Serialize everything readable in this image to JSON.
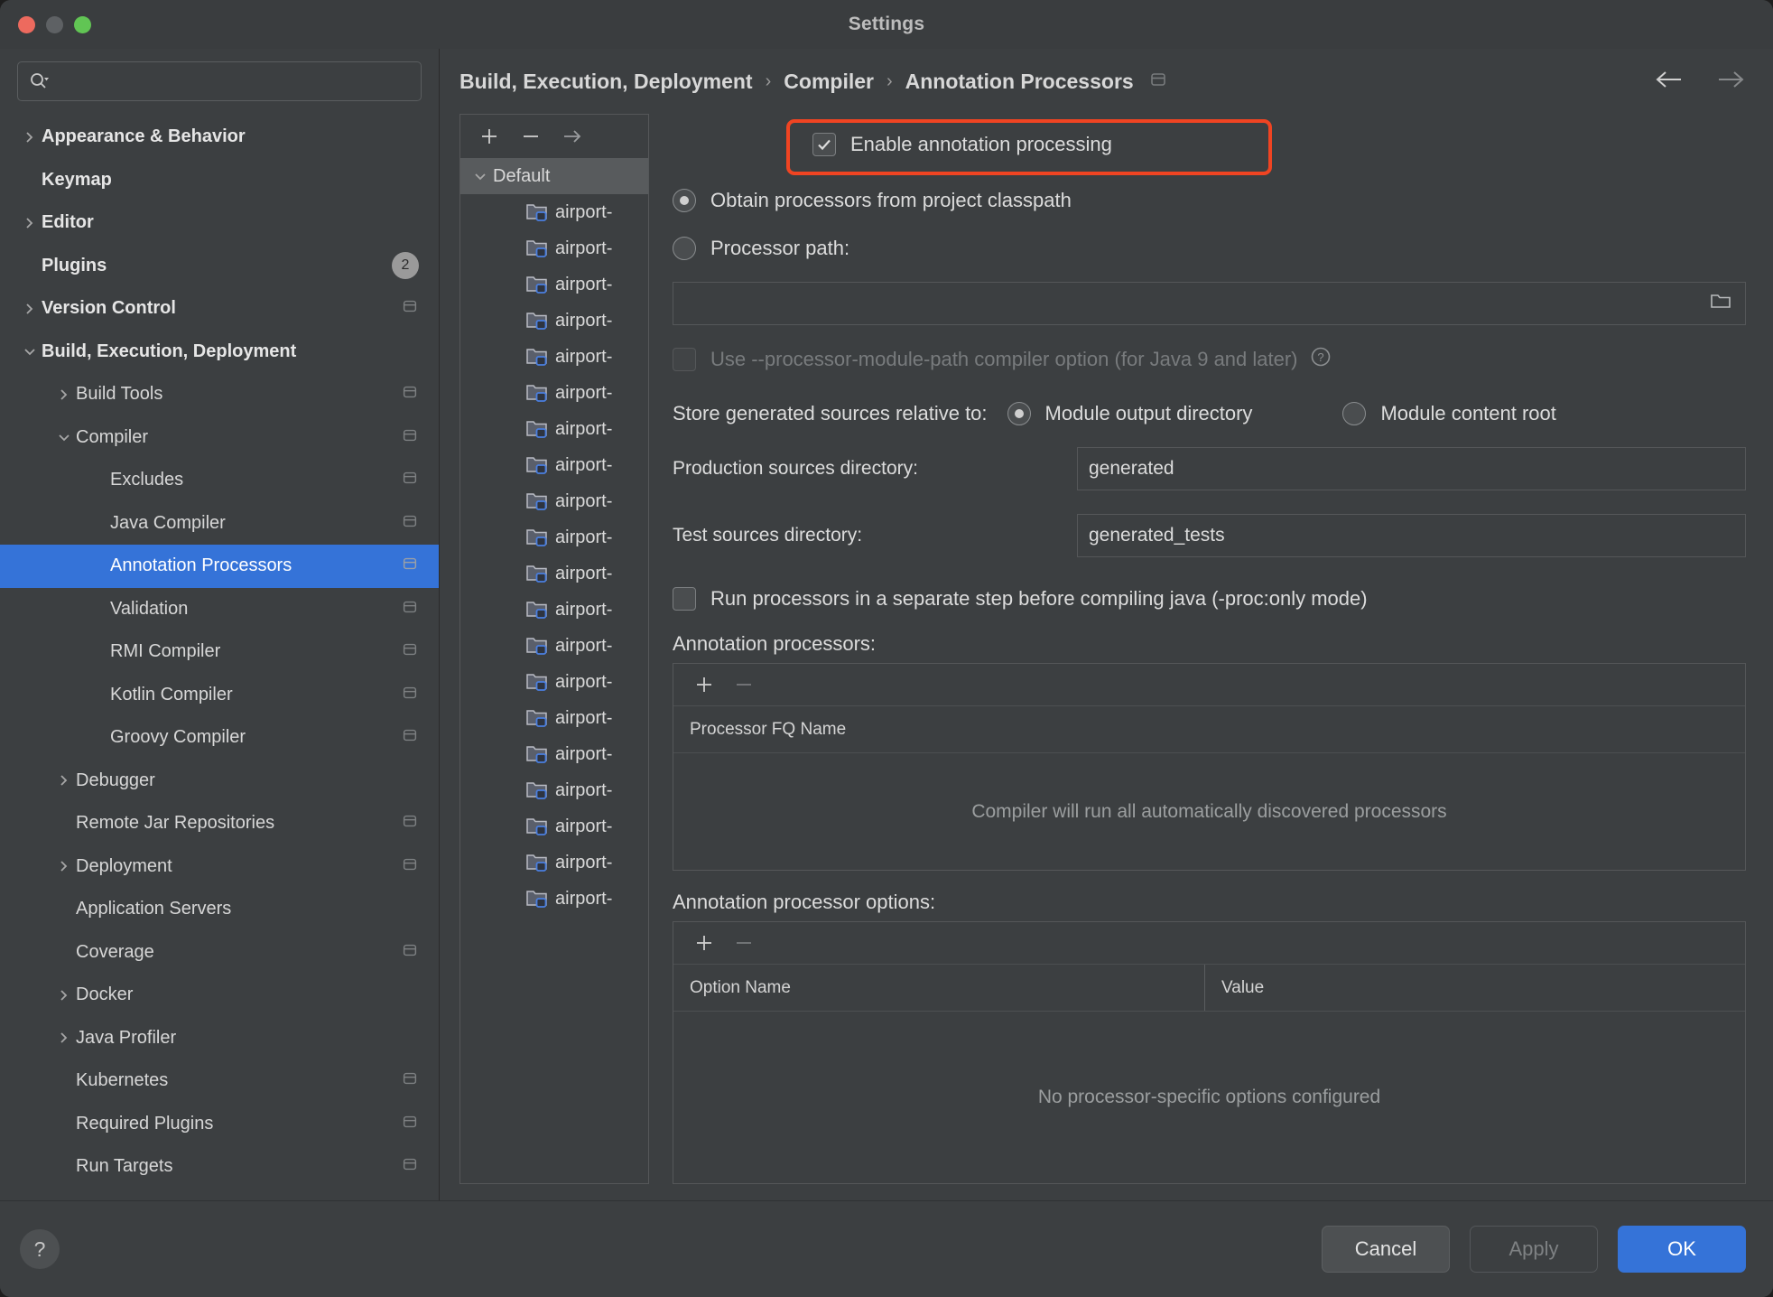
{
  "window": {
    "title": "Settings",
    "traffic_lights": [
      "close-red",
      "minimize-yellow",
      "zoom-green"
    ]
  },
  "search": {
    "value": "",
    "placeholder": ""
  },
  "sidebar": {
    "items": [
      {
        "label": "Appearance & Behavior",
        "indent": 0,
        "chevron": "right",
        "bold": true
      },
      {
        "label": "Keymap",
        "indent": 0,
        "chevron": "none",
        "bold": true
      },
      {
        "label": "Editor",
        "indent": 0,
        "chevron": "right",
        "bold": true
      },
      {
        "label": "Plugins",
        "indent": 0,
        "chevron": "none",
        "bold": true,
        "badge": "2"
      },
      {
        "label": "Version Control",
        "indent": 0,
        "chevron": "right",
        "bold": true,
        "project_icon": true
      },
      {
        "label": "Build, Execution, Deployment",
        "indent": 0,
        "chevron": "down",
        "bold": true
      },
      {
        "label": "Build Tools",
        "indent": 1,
        "chevron": "right",
        "project_icon": true
      },
      {
        "label": "Compiler",
        "indent": 1,
        "chevron": "down",
        "project_icon": true
      },
      {
        "label": "Excludes",
        "indent": 2,
        "chevron": "none",
        "project_icon": true
      },
      {
        "label": "Java Compiler",
        "indent": 2,
        "chevron": "none",
        "project_icon": true
      },
      {
        "label": "Annotation Processors",
        "indent": 2,
        "chevron": "none",
        "selected": true,
        "project_icon": true
      },
      {
        "label": "Validation",
        "indent": 2,
        "chevron": "none",
        "project_icon": true
      },
      {
        "label": "RMI Compiler",
        "indent": 2,
        "chevron": "none",
        "project_icon": true
      },
      {
        "label": "Kotlin Compiler",
        "indent": 2,
        "chevron": "none",
        "project_icon": true
      },
      {
        "label": "Groovy Compiler",
        "indent": 2,
        "chevron": "none",
        "project_icon": true
      },
      {
        "label": "Debugger",
        "indent": 1,
        "chevron": "right"
      },
      {
        "label": "Remote Jar Repositories",
        "indent": 1,
        "chevron": "none",
        "project_icon": true
      },
      {
        "label": "Deployment",
        "indent": 1,
        "chevron": "right",
        "project_icon": true
      },
      {
        "label": "Application Servers",
        "indent": 1,
        "chevron": "none"
      },
      {
        "label": "Coverage",
        "indent": 1,
        "chevron": "none",
        "project_icon": true
      },
      {
        "label": "Docker",
        "indent": 1,
        "chevron": "right"
      },
      {
        "label": "Java Profiler",
        "indent": 1,
        "chevron": "right"
      },
      {
        "label": "Kubernetes",
        "indent": 1,
        "chevron": "none",
        "project_icon": true
      },
      {
        "label": "Required Plugins",
        "indent": 1,
        "chevron": "none",
        "project_icon": true
      },
      {
        "label": "Run Targets",
        "indent": 1,
        "chevron": "none",
        "project_icon": true
      }
    ]
  },
  "breadcrumb": {
    "crumbs": [
      "Build, Execution, Deployment",
      "Compiler",
      "Annotation Processors"
    ],
    "separator": "›",
    "nav_back": "←",
    "nav_forward": "→"
  },
  "module_list": {
    "toolbar": {
      "add": "+",
      "remove": "—",
      "copy": "→"
    },
    "root": {
      "label": "Default",
      "expanded": true
    },
    "modules": [
      "airport-",
      "airport-",
      "airport-",
      "airport-",
      "airport-",
      "airport-",
      "airport-",
      "airport-",
      "airport-",
      "airport-",
      "airport-",
      "airport-",
      "airport-",
      "airport-",
      "airport-",
      "airport-",
      "airport-",
      "airport-",
      "airport-",
      "airport-"
    ]
  },
  "form": {
    "enable_annotation_processing": {
      "label": "Enable annotation processing",
      "checked": true,
      "highlighted": true,
      "highlight_color": "#f04422"
    },
    "source_radio_group": {
      "options": [
        {
          "label": "Obtain processors from project classpath",
          "selected": true
        },
        {
          "label": "Processor path:",
          "selected": false
        }
      ]
    },
    "processor_path": {
      "value": "",
      "browse_icon": "folder-icon"
    },
    "processor_module_path": {
      "label": "Use --processor-module-path compiler option (for Java 9 and later)",
      "checked": false,
      "disabled": true,
      "help_icon": "question-circle-icon"
    },
    "store_generated": {
      "label": "Store generated sources relative to:",
      "options": [
        {
          "label": "Module output directory",
          "selected": true
        },
        {
          "label": "Module content root",
          "selected": false
        }
      ]
    },
    "production_sources": {
      "label": "Production sources directory:",
      "value": "generated"
    },
    "test_sources": {
      "label": "Test sources directory:",
      "value": "generated_tests"
    },
    "separate_step": {
      "label": "Run processors in a separate step before compiling java (-proc:only mode)",
      "checked": false
    },
    "processors_table": {
      "title": "Annotation processors:",
      "toolbar": {
        "add": "+",
        "remove": "—"
      },
      "columns": [
        "Processor FQ Name"
      ],
      "rows": [],
      "empty_text": "Compiler will run all automatically discovered processors"
    },
    "options_table": {
      "title": "Annotation processor options:",
      "toolbar": {
        "add": "+",
        "remove": "—"
      },
      "columns": [
        "Option Name",
        "Value"
      ],
      "rows": [],
      "empty_text": "No processor-specific options configured"
    }
  },
  "footer": {
    "help": "?",
    "cancel": "Cancel",
    "apply": "Apply",
    "ok": "OK"
  }
}
